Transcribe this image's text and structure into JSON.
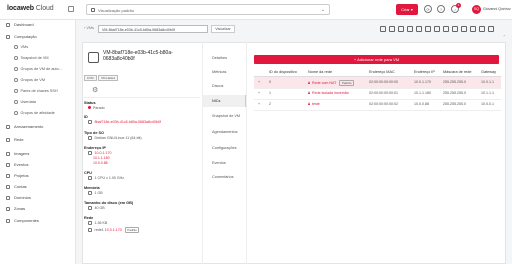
{
  "brand": {
    "part1": "locaweb",
    "part2": "Cloud"
  },
  "scope": {
    "label": "Visualização padrão"
  },
  "topbar": {
    "create_label": "Criar ▾",
    "notif_count": "4",
    "avatar_initials": "SQ",
    "username": "Giovanni Queiroz"
  },
  "sidebar": {
    "dashboard": "Dashboard",
    "compute": "Computação",
    "compute_items": [
      "VMs",
      "Snapshot de VM",
      "Grupos de VM de auto...",
      "Grupos de VM",
      "Pares de chaves SSH",
      "Userdata",
      "Grupos de afinidade"
    ],
    "storage": "Armazenamento",
    "network": "Rede",
    "images": "Imagens",
    "events": "Eventos",
    "projects": "Projetos",
    "accounts": "Contas",
    "domains": "Domínios",
    "zones": "Zonas",
    "components": "Componentes"
  },
  "breadcrumb": {
    "root": "VMs",
    "current": "VM-8baf718e-e03b-41c5-b80a-0683a8c40b0f",
    "view_label": "Visualizar"
  },
  "vm": {
    "title": "VM-8baf718e-e03b-41c5-b80a-0683a8c40b0f",
    "tags": [
      "KVM",
      "VM Halted"
    ],
    "status_label": "Status",
    "status_value": "Parado",
    "id_label": "ID",
    "id_value": "8baf718e-e03b-41c5-b80a-0683a8c40b0f",
    "os_label": "Tipo de SO",
    "os_value": "Debian GNU/Linux 11 (64-bit)",
    "ip_label": "Endereço IP",
    "ip_values": [
      "10.0.1.170",
      "10.1.1.180",
      "10.0.0.88"
    ],
    "cpu_label": "CPU",
    "cpu_value": "1 CPU x 1.00 GHz",
    "mem_label": "Memória",
    "mem_value": "1 GB",
    "disk_label": "Tamanho do disco (em GB)",
    "disk_value": "40 GB",
    "net_label": "Rede",
    "net_value": "1.36 KB",
    "net_default_name": "rede1",
    "net_default_ip": "10.0.1.170",
    "net_default_pill": "Padrão"
  },
  "tabs": [
    "Detalhes",
    "Métricas",
    "Discos",
    "NICs",
    "Snapshot de VM",
    "Agendamentos",
    "Configurações",
    "Eventos",
    "Comentários"
  ],
  "table": {
    "add_label": "+ Adicionar rede para VM",
    "headers": [
      "ID do dispositivo",
      "Nome da rede",
      "Endereço MAC",
      "Endereço IP",
      "Máscara de rede",
      "Gateway"
    ],
    "rows": [
      {
        "device": "0",
        "name": "Rede com NAT",
        "pill": "Padrão",
        "mac": "02:00:00:00:00:00",
        "ip": "10.0.1.170",
        "mask": "255.255.255.0",
        "gw": "10.0.1.1"
      },
      {
        "device": "1",
        "name": "Rede isolada incremão",
        "pill": "",
        "mac": "02:00:00:00:00:01",
        "ip": "10.1.1.180",
        "mask": "255.255.255.0",
        "gw": "10.1.1.1"
      },
      {
        "device": "2",
        "name": "teste",
        "pill": "",
        "mac": "02:00:00:00:00:02",
        "ip": "10.0.0.88",
        "mask": "255.255.255.0",
        "gw": "10.0.0.1"
      }
    ]
  },
  "colors": {
    "accent": "#e2173d"
  }
}
